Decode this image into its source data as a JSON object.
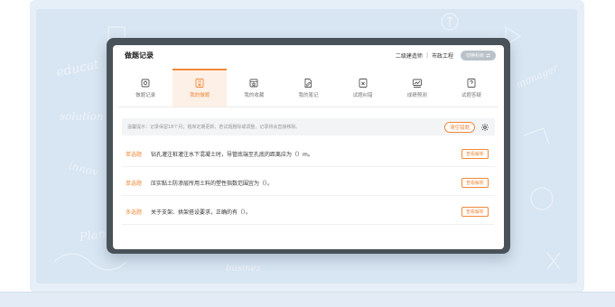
{
  "background": {
    "doodles": [
      "educat",
      "solution",
      "innov",
      "manager",
      "busines",
      "Plan"
    ]
  },
  "header": {
    "title": "做题记录",
    "course": "二级建造师",
    "separator": "|",
    "subject": "市政工程",
    "switch_label": "切换科目"
  },
  "tabs": [
    {
      "label": "做题记录",
      "icon": "record-icon",
      "active": false
    },
    {
      "label": "我的做题",
      "icon": "practice-icon",
      "active": true
    },
    {
      "label": "我的收藏",
      "icon": "favorite-icon",
      "active": false
    },
    {
      "label": "我的笔记",
      "icon": "note-icon",
      "active": false
    },
    {
      "label": "试题纠错",
      "icon": "error-correction-icon",
      "active": false
    },
    {
      "label": "成绩预测",
      "icon": "score-prediction-icon",
      "active": false
    },
    {
      "label": "试题答疑",
      "icon": "qa-icon",
      "active": false
    }
  ],
  "notice": {
    "text": "温馨提示：记录保留18个月；题库定期更新，若试题删除或调整，记录将会直接移除。",
    "clear_button": "清空错题"
  },
  "questions": [
    {
      "type": "单选题",
      "text": "钻孔灌注桩灌注水下混凝土时，导管底端至孔底的距离应为（）m。",
      "action": "查看解析"
    },
    {
      "type": "单选题",
      "text": "压实黏土防渗层所用土料的塑性指数范围宜为（）。",
      "action": "查看解析"
    },
    {
      "type": "多选题",
      "text": "关于支架、拱架搭设要求，正确的有（）。",
      "action": "查看解析"
    }
  ],
  "colors": {
    "accent": "#f0883a",
    "device_frame": "#4a5259",
    "background": "#d8e5f2"
  }
}
